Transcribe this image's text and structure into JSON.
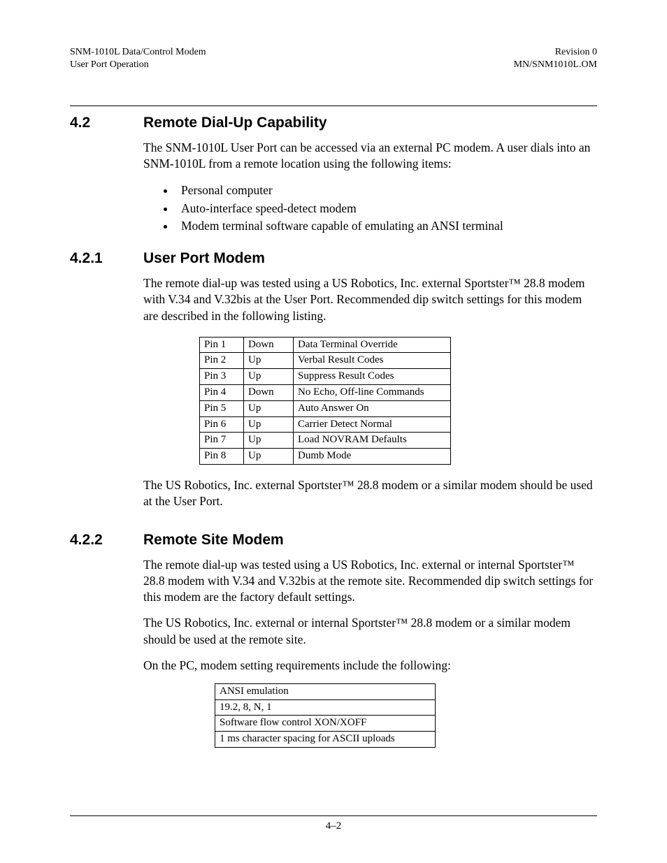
{
  "header": {
    "left1": "SNM-1010L Data/Control Modem",
    "left2": "User Port Operation",
    "right1": "Revision 0",
    "right2": "MN/SNM1010L.OM"
  },
  "s42": {
    "num": "4.2",
    "title": "Remote Dial-Up Capability",
    "p1": "The SNM-1010L User Port can be accessed via an external PC modem. A user dials into an SNM-1010L from a remote location using the following items:",
    "bullets": [
      "Personal computer",
      "Auto-interface speed-detect modem",
      "Modem terminal software capable of emulating an ANSI terminal"
    ]
  },
  "s421": {
    "num": "4.2.1",
    "title": "User Port Modem",
    "p1": "The remote dial-up was tested using a US Robotics, Inc. external Sportster™ 28.8 modem with V.34 and V.32bis at the User Port. Recommended dip switch settings for this modem are described in the following listing.",
    "pins": [
      {
        "pin": "Pin 1",
        "pos": "Down",
        "desc": "Data Terminal Override"
      },
      {
        "pin": "Pin 2",
        "pos": "Up",
        "desc": "Verbal Result Codes"
      },
      {
        "pin": "Pin 3",
        "pos": "Up",
        "desc": "Suppress Result Codes"
      },
      {
        "pin": "Pin 4",
        "pos": "Down",
        "desc": "No Echo, Off-line Commands"
      },
      {
        "pin": "Pin 5",
        "pos": "Up",
        "desc": "Auto Answer On"
      },
      {
        "pin": "Pin 6",
        "pos": "Up",
        "desc": "Carrier Detect Normal"
      },
      {
        "pin": "Pin 7",
        "pos": "Up",
        "desc": "Load NOVRAM Defaults"
      },
      {
        "pin": "Pin 8",
        "pos": "Up",
        "desc": "Dumb Mode"
      }
    ],
    "p2": "The US Robotics, Inc. external Sportster™ 28.8 modem or a similar modem should be used at the User Port."
  },
  "s422": {
    "num": "4.2.2",
    "title": "Remote Site Modem",
    "p1": "The remote dial-up was tested using a US Robotics, Inc. external or internal Sportster™ 28.8 modem with V.34 and V.32bis at the remote site. Recommended dip switch settings for this modem are the factory default settings.",
    "p2": "The US Robotics, Inc. external or internal Sportster™ 28.8 modem or a similar modem should be used at the remote site.",
    "p3": "On the PC, modem setting requirements include the following:",
    "reqs": [
      "ANSI emulation",
      "19.2, 8, N, 1",
      "Software flow control XON/XOFF",
      "1 ms character spacing for ASCII uploads"
    ]
  },
  "footer": {
    "pagenum": "4–2"
  }
}
